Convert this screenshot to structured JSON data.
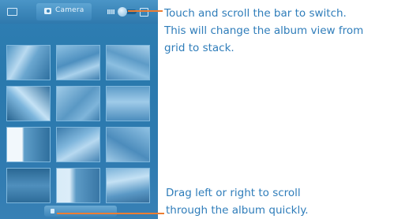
{
  "screen": {
    "album_label": "Camera",
    "icons": {
      "home": "home-icon",
      "camera": "camera-icon",
      "grid": "grid-view-icon",
      "stack": "stack-view-icon"
    }
  },
  "thumbnails": [
    {
      "name": "photo-1",
      "variant": "a"
    },
    {
      "name": "photo-2",
      "variant": "b"
    },
    {
      "name": "photo-3",
      "variant": "c"
    },
    {
      "name": "photo-4",
      "variant": "d"
    },
    {
      "name": "photo-5",
      "variant": "e"
    },
    {
      "name": "photo-6",
      "variant": "f"
    },
    {
      "name": "photo-7",
      "variant": "g"
    },
    {
      "name": "photo-8",
      "variant": "h"
    },
    {
      "name": "photo-9",
      "variant": "i"
    },
    {
      "name": "photo-10",
      "variant": "j"
    },
    {
      "name": "photo-11",
      "variant": "k"
    },
    {
      "name": "photo-12",
      "variant": "l"
    }
  ],
  "callouts": {
    "switch": {
      "lines": [
        "Touch and scroll the bar to switch.",
        "This will change the album view from",
        "grid to stack."
      ]
    },
    "scroll": {
      "lines": [
        "Drag left or right to scroll",
        "through the album quickly."
      ]
    }
  },
  "colors": {
    "screen_blue": "#2f7fb4",
    "callout_text": "#2f7dba",
    "leader_line": "#ed7d31"
  }
}
